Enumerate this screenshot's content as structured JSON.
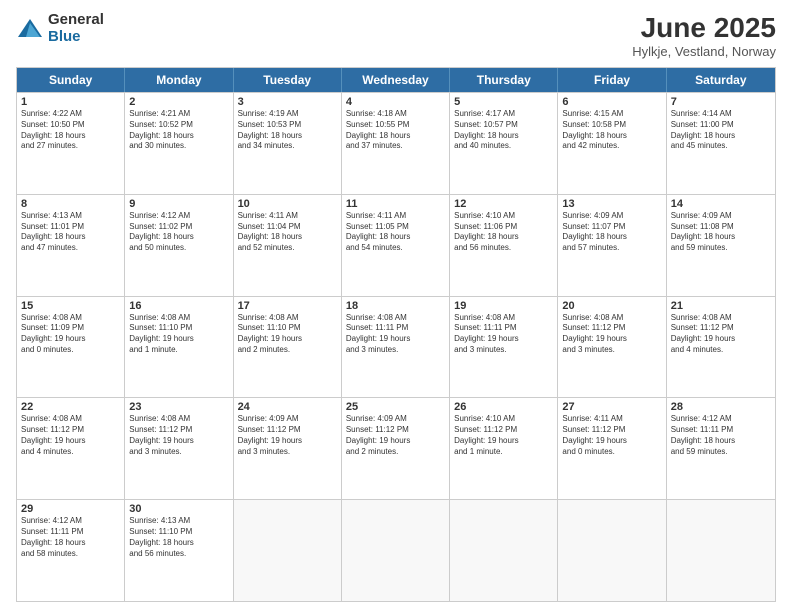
{
  "logo": {
    "general": "General",
    "blue": "Blue"
  },
  "title": {
    "month": "June 2025",
    "location": "Hylkje, Vestland, Norway"
  },
  "days": [
    "Sunday",
    "Monday",
    "Tuesday",
    "Wednesday",
    "Thursday",
    "Friday",
    "Saturday"
  ],
  "rows": [
    [
      {
        "day": "1",
        "text": "Sunrise: 4:22 AM\nSunset: 10:50 PM\nDaylight: 18 hours\nand 27 minutes."
      },
      {
        "day": "2",
        "text": "Sunrise: 4:21 AM\nSunset: 10:52 PM\nDaylight: 18 hours\nand 30 minutes."
      },
      {
        "day": "3",
        "text": "Sunrise: 4:19 AM\nSunset: 10:53 PM\nDaylight: 18 hours\nand 34 minutes."
      },
      {
        "day": "4",
        "text": "Sunrise: 4:18 AM\nSunset: 10:55 PM\nDaylight: 18 hours\nand 37 minutes."
      },
      {
        "day": "5",
        "text": "Sunrise: 4:17 AM\nSunset: 10:57 PM\nDaylight: 18 hours\nand 40 minutes."
      },
      {
        "day": "6",
        "text": "Sunrise: 4:15 AM\nSunset: 10:58 PM\nDaylight: 18 hours\nand 42 minutes."
      },
      {
        "day": "7",
        "text": "Sunrise: 4:14 AM\nSunset: 11:00 PM\nDaylight: 18 hours\nand 45 minutes."
      }
    ],
    [
      {
        "day": "8",
        "text": "Sunrise: 4:13 AM\nSunset: 11:01 PM\nDaylight: 18 hours\nand 47 minutes."
      },
      {
        "day": "9",
        "text": "Sunrise: 4:12 AM\nSunset: 11:02 PM\nDaylight: 18 hours\nand 50 minutes."
      },
      {
        "day": "10",
        "text": "Sunrise: 4:11 AM\nSunset: 11:04 PM\nDaylight: 18 hours\nand 52 minutes."
      },
      {
        "day": "11",
        "text": "Sunrise: 4:11 AM\nSunset: 11:05 PM\nDaylight: 18 hours\nand 54 minutes."
      },
      {
        "day": "12",
        "text": "Sunrise: 4:10 AM\nSunset: 11:06 PM\nDaylight: 18 hours\nand 56 minutes."
      },
      {
        "day": "13",
        "text": "Sunrise: 4:09 AM\nSunset: 11:07 PM\nDaylight: 18 hours\nand 57 minutes."
      },
      {
        "day": "14",
        "text": "Sunrise: 4:09 AM\nSunset: 11:08 PM\nDaylight: 18 hours\nand 59 minutes."
      }
    ],
    [
      {
        "day": "15",
        "text": "Sunrise: 4:08 AM\nSunset: 11:09 PM\nDaylight: 19 hours\nand 0 minutes."
      },
      {
        "day": "16",
        "text": "Sunrise: 4:08 AM\nSunset: 11:10 PM\nDaylight: 19 hours\nand 1 minute."
      },
      {
        "day": "17",
        "text": "Sunrise: 4:08 AM\nSunset: 11:10 PM\nDaylight: 19 hours\nand 2 minutes."
      },
      {
        "day": "18",
        "text": "Sunrise: 4:08 AM\nSunset: 11:11 PM\nDaylight: 19 hours\nand 3 minutes."
      },
      {
        "day": "19",
        "text": "Sunrise: 4:08 AM\nSunset: 11:11 PM\nDaylight: 19 hours\nand 3 minutes."
      },
      {
        "day": "20",
        "text": "Sunrise: 4:08 AM\nSunset: 11:12 PM\nDaylight: 19 hours\nand 3 minutes."
      },
      {
        "day": "21",
        "text": "Sunrise: 4:08 AM\nSunset: 11:12 PM\nDaylight: 19 hours\nand 4 minutes."
      }
    ],
    [
      {
        "day": "22",
        "text": "Sunrise: 4:08 AM\nSunset: 11:12 PM\nDaylight: 19 hours\nand 4 minutes."
      },
      {
        "day": "23",
        "text": "Sunrise: 4:08 AM\nSunset: 11:12 PM\nDaylight: 19 hours\nand 3 minutes."
      },
      {
        "day": "24",
        "text": "Sunrise: 4:09 AM\nSunset: 11:12 PM\nDaylight: 19 hours\nand 3 minutes."
      },
      {
        "day": "25",
        "text": "Sunrise: 4:09 AM\nSunset: 11:12 PM\nDaylight: 19 hours\nand 2 minutes."
      },
      {
        "day": "26",
        "text": "Sunrise: 4:10 AM\nSunset: 11:12 PM\nDaylight: 19 hours\nand 1 minute."
      },
      {
        "day": "27",
        "text": "Sunrise: 4:11 AM\nSunset: 11:12 PM\nDaylight: 19 hours\nand 0 minutes."
      },
      {
        "day": "28",
        "text": "Sunrise: 4:12 AM\nSunset: 11:11 PM\nDaylight: 18 hours\nand 59 minutes."
      }
    ],
    [
      {
        "day": "29",
        "text": "Sunrise: 4:12 AM\nSunset: 11:11 PM\nDaylight: 18 hours\nand 58 minutes."
      },
      {
        "day": "30",
        "text": "Sunrise: 4:13 AM\nSunset: 11:10 PM\nDaylight: 18 hours\nand 56 minutes."
      },
      {
        "day": "",
        "text": ""
      },
      {
        "day": "",
        "text": ""
      },
      {
        "day": "",
        "text": ""
      },
      {
        "day": "",
        "text": ""
      },
      {
        "day": "",
        "text": ""
      }
    ]
  ]
}
